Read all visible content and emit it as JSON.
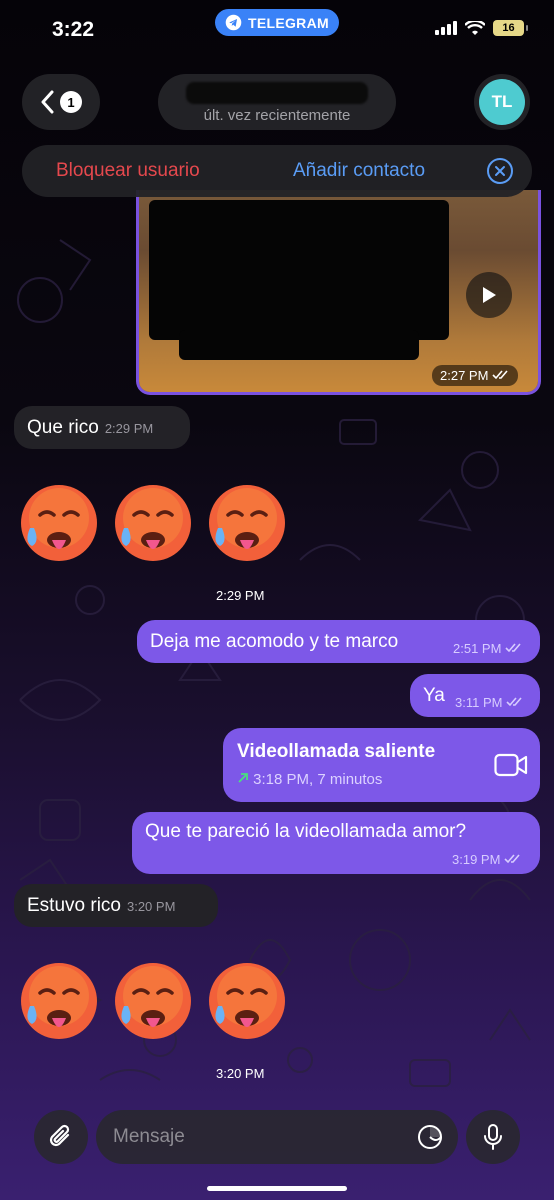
{
  "status_bar": {
    "time": "3:22",
    "app_pill": "TELEGRAM",
    "battery": "16"
  },
  "header": {
    "back_count": "1",
    "contact_subtitle": "últ. vez recientemente",
    "avatar_initials": "TL"
  },
  "banner": {
    "block_label": "Bloquear usuario",
    "add_label": "Añadir contacto"
  },
  "video_message": {
    "time": "2:27 PM"
  },
  "messages": [
    {
      "text": "Que rico",
      "time": "2:29 PM"
    },
    {
      "text": "2:29 PM"
    },
    {
      "text": "Deja me acomodo y te marco",
      "time": "2:51 PM"
    },
    {
      "text": "Ya",
      "time": "3:11 PM"
    },
    {
      "title": "Videollamada saliente",
      "detail": "3:18 PM, 7 minutos"
    },
    {
      "text": "Que te pareció la videollamada amor?",
      "time": "3:19 PM"
    },
    {
      "text": "Estuvo rico",
      "time": "3:20 PM"
    },
    {
      "text": "3:20 PM"
    }
  ],
  "composer": {
    "placeholder": "Mensaje"
  },
  "colors": {
    "outgoing": "#7d58e8",
    "incoming": "#232227",
    "block": "#e5484d",
    "link": "#5a9cf5"
  },
  "icons": [
    "telegram-icon",
    "signal-icon",
    "wifi-icon",
    "chevron-left-icon",
    "close-circle-icon",
    "play-icon",
    "double-check-icon",
    "video-camera-icon",
    "outgoing-arrow-icon",
    "paperclip-icon",
    "sticker-icon",
    "microphone-icon",
    "hot-face-emoji"
  ]
}
